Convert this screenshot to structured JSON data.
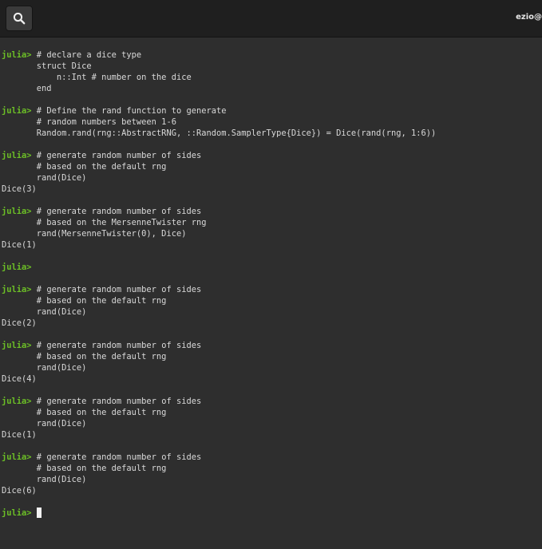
{
  "window": {
    "title": "ezio@"
  },
  "icons": {
    "search": "search-icon"
  },
  "colors": {
    "prompt": "#6cbf26",
    "text": "#d9d9d9",
    "background": "#2e2e2e"
  },
  "terminal": {
    "prompt": "julia>",
    "lines": [
      {
        "p": true,
        "t": " # declare a dice type"
      },
      {
        "p": false,
        "t": "       struct Dice"
      },
      {
        "p": false,
        "t": "           n::Int # number on the dice"
      },
      {
        "p": false,
        "t": "       end"
      },
      {
        "p": false,
        "t": ""
      },
      {
        "p": true,
        "t": " # Define the rand function to generate"
      },
      {
        "p": false,
        "t": "       # random numbers between 1-6"
      },
      {
        "p": false,
        "t": "       Random.rand(rng::AbstractRNG, ::Random.SamplerType{Dice}) = Dice(rand(rng, 1:6))"
      },
      {
        "p": false,
        "t": ""
      },
      {
        "p": true,
        "t": " # generate random number of sides"
      },
      {
        "p": false,
        "t": "       # based on the default rng"
      },
      {
        "p": false,
        "t": "       rand(Dice)"
      },
      {
        "p": false,
        "t": "Dice(3)"
      },
      {
        "p": false,
        "t": ""
      },
      {
        "p": true,
        "t": " # generate random number of sides"
      },
      {
        "p": false,
        "t": "       # based on the MersenneTwister rng"
      },
      {
        "p": false,
        "t": "       rand(MersenneTwister(0), Dice)"
      },
      {
        "p": false,
        "t": "Dice(1)"
      },
      {
        "p": false,
        "t": ""
      },
      {
        "p": true,
        "t": ""
      },
      {
        "p": false,
        "t": ""
      },
      {
        "p": true,
        "t": " # generate random number of sides"
      },
      {
        "p": false,
        "t": "       # based on the default rng"
      },
      {
        "p": false,
        "t": "       rand(Dice)"
      },
      {
        "p": false,
        "t": "Dice(2)"
      },
      {
        "p": false,
        "t": ""
      },
      {
        "p": true,
        "t": " # generate random number of sides"
      },
      {
        "p": false,
        "t": "       # based on the default rng"
      },
      {
        "p": false,
        "t": "       rand(Dice)"
      },
      {
        "p": false,
        "t": "Dice(4)"
      },
      {
        "p": false,
        "t": ""
      },
      {
        "p": true,
        "t": " # generate random number of sides"
      },
      {
        "p": false,
        "t": "       # based on the default rng"
      },
      {
        "p": false,
        "t": "       rand(Dice)"
      },
      {
        "p": false,
        "t": "Dice(1)"
      },
      {
        "p": false,
        "t": ""
      },
      {
        "p": true,
        "t": " # generate random number of sides"
      },
      {
        "p": false,
        "t": "       # based on the default rng"
      },
      {
        "p": false,
        "t": "       rand(Dice)"
      },
      {
        "p": false,
        "t": "Dice(6)"
      },
      {
        "p": false,
        "t": ""
      },
      {
        "p": true,
        "t": " ",
        "cursor": true
      }
    ]
  }
}
